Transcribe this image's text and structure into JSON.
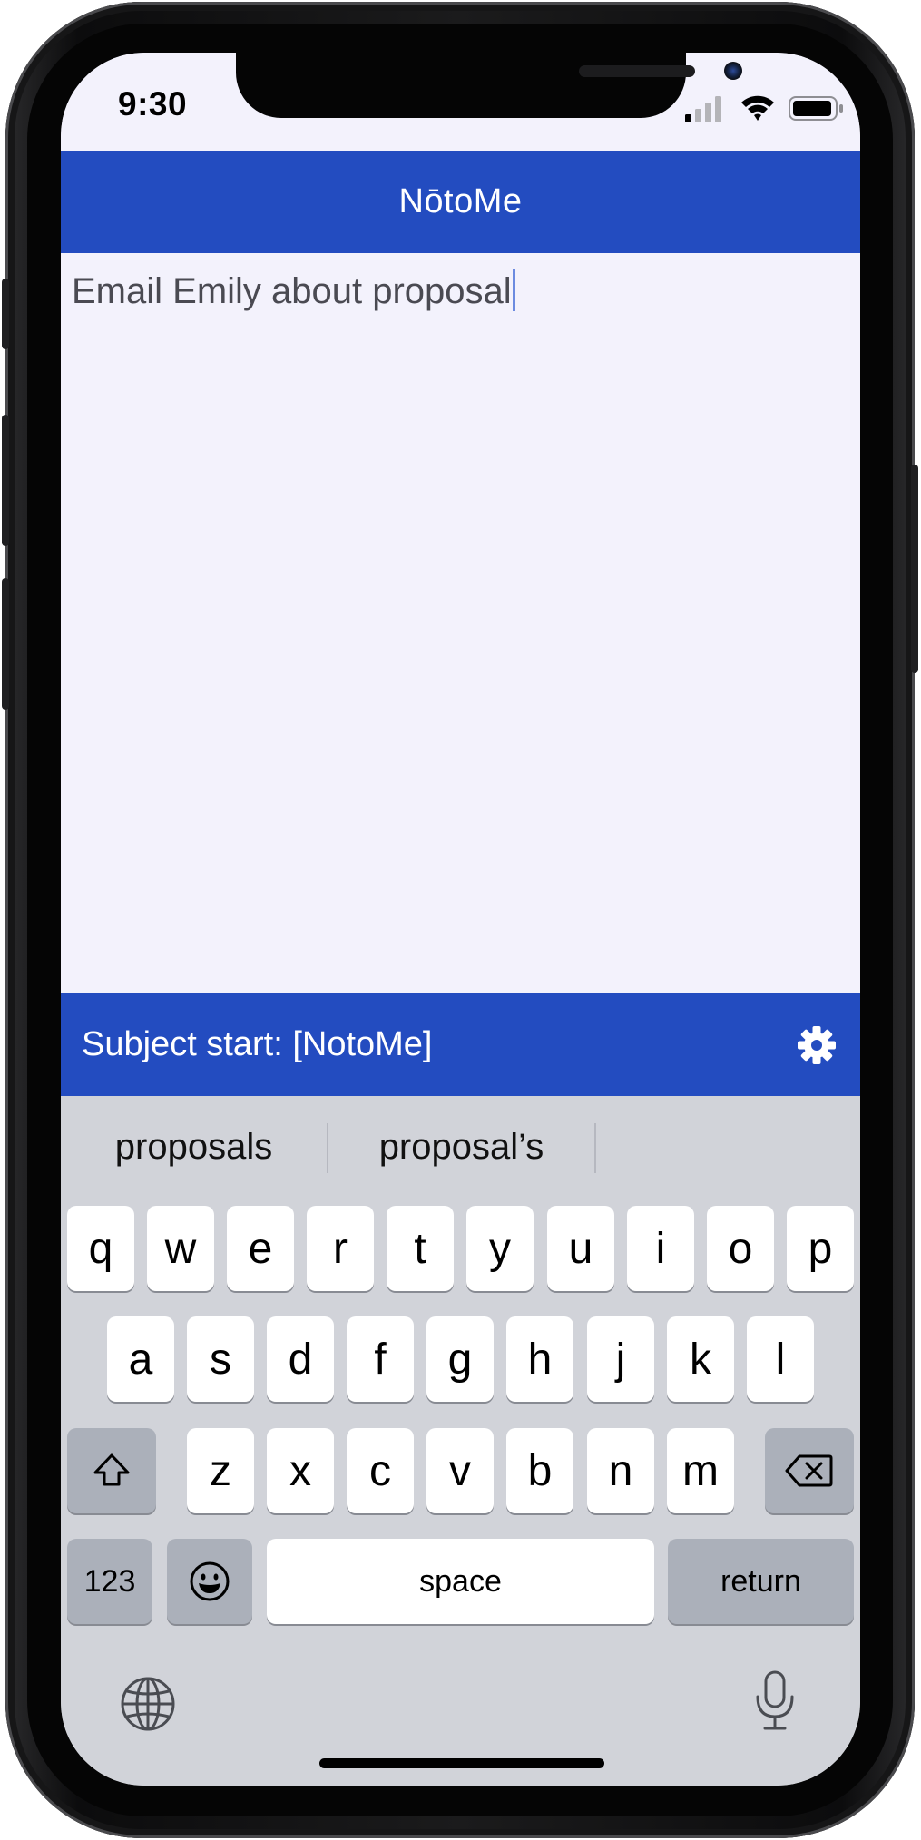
{
  "status_bar": {
    "time": "9:30"
  },
  "app": {
    "title": "NōtoMe"
  },
  "note": {
    "text": "Email Emily about proposal"
  },
  "footer": {
    "subject_label": "Subject start: [NotoMe]",
    "settings_icon": "gear-icon"
  },
  "keyboard": {
    "suggestions": [
      "proposals",
      "proposal’s",
      ""
    ],
    "row1": [
      "q",
      "w",
      "e",
      "r",
      "t",
      "y",
      "u",
      "i",
      "o",
      "p"
    ],
    "row2": [
      "a",
      "s",
      "d",
      "f",
      "g",
      "h",
      "j",
      "k",
      "l"
    ],
    "row3": [
      "z",
      "x",
      "c",
      "v",
      "b",
      "n",
      "m"
    ],
    "numbers_label": "123",
    "space_label": "space",
    "return_label": "return",
    "shift_icon": "shift-icon",
    "delete_icon": "backspace-icon",
    "emoji_icon": "emoji-icon",
    "globe_icon": "globe-icon",
    "mic_icon": "microphone-icon"
  },
  "colors": {
    "accent": "#234cc0",
    "background": "#f3f2fc",
    "keyboard": "#d1d3d9"
  }
}
